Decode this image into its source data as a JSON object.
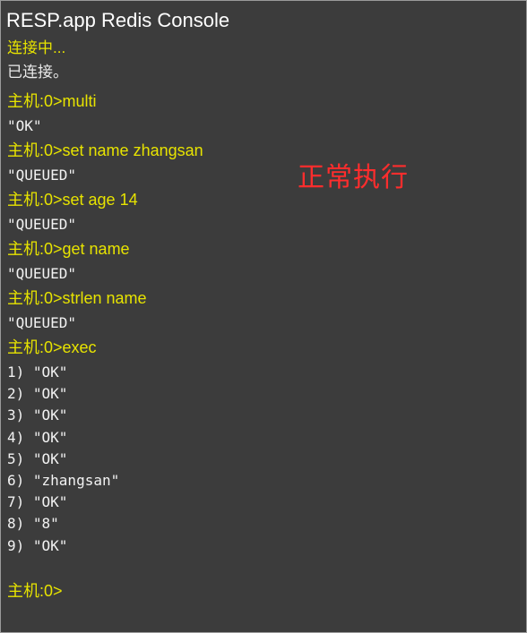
{
  "window": {
    "title": "RESP.app Redis Console"
  },
  "status": {
    "connecting": "连接中...",
    "connected": "已连接。"
  },
  "session": [
    {
      "type": "cmd",
      "text": "主机:0>multi"
    },
    {
      "type": "resp",
      "text": "\"OK\""
    },
    {
      "type": "cmd",
      "text": "主机:0>set name zhangsan"
    },
    {
      "type": "resp",
      "text": "\"QUEUED\""
    },
    {
      "type": "cmd",
      "text": "主机:0>set age 14"
    },
    {
      "type": "resp",
      "text": "\"QUEUED\""
    },
    {
      "type": "cmd",
      "text": "主机:0>get name"
    },
    {
      "type": "resp",
      "text": "\"QUEUED\""
    },
    {
      "type": "cmd",
      "text": "主机:0>strlen name"
    },
    {
      "type": "resp",
      "text": "\"QUEUED\""
    },
    {
      "type": "cmd",
      "text": "主机:0>exec"
    },
    {
      "type": "resp",
      "text": "1) \"OK\""
    },
    {
      "type": "resp",
      "text": "2) \"OK\""
    },
    {
      "type": "resp",
      "text": "3) \"OK\""
    },
    {
      "type": "resp",
      "text": "4) \"OK\""
    },
    {
      "type": "resp",
      "text": "5) \"OK\""
    },
    {
      "type": "resp",
      "text": "6) \"zhangsan\""
    },
    {
      "type": "resp",
      "text": "7) \"OK\""
    },
    {
      "type": "resp",
      "text": "8) \"8\""
    },
    {
      "type": "resp",
      "text": "9) \"OK\""
    }
  ],
  "prompt": "主机:0>",
  "annotation": "正常执行",
  "colors": {
    "background": "#3c3c3c",
    "command": "#e7e300",
    "response": "#f2f2f2",
    "annotation": "#ff2d2d"
  }
}
